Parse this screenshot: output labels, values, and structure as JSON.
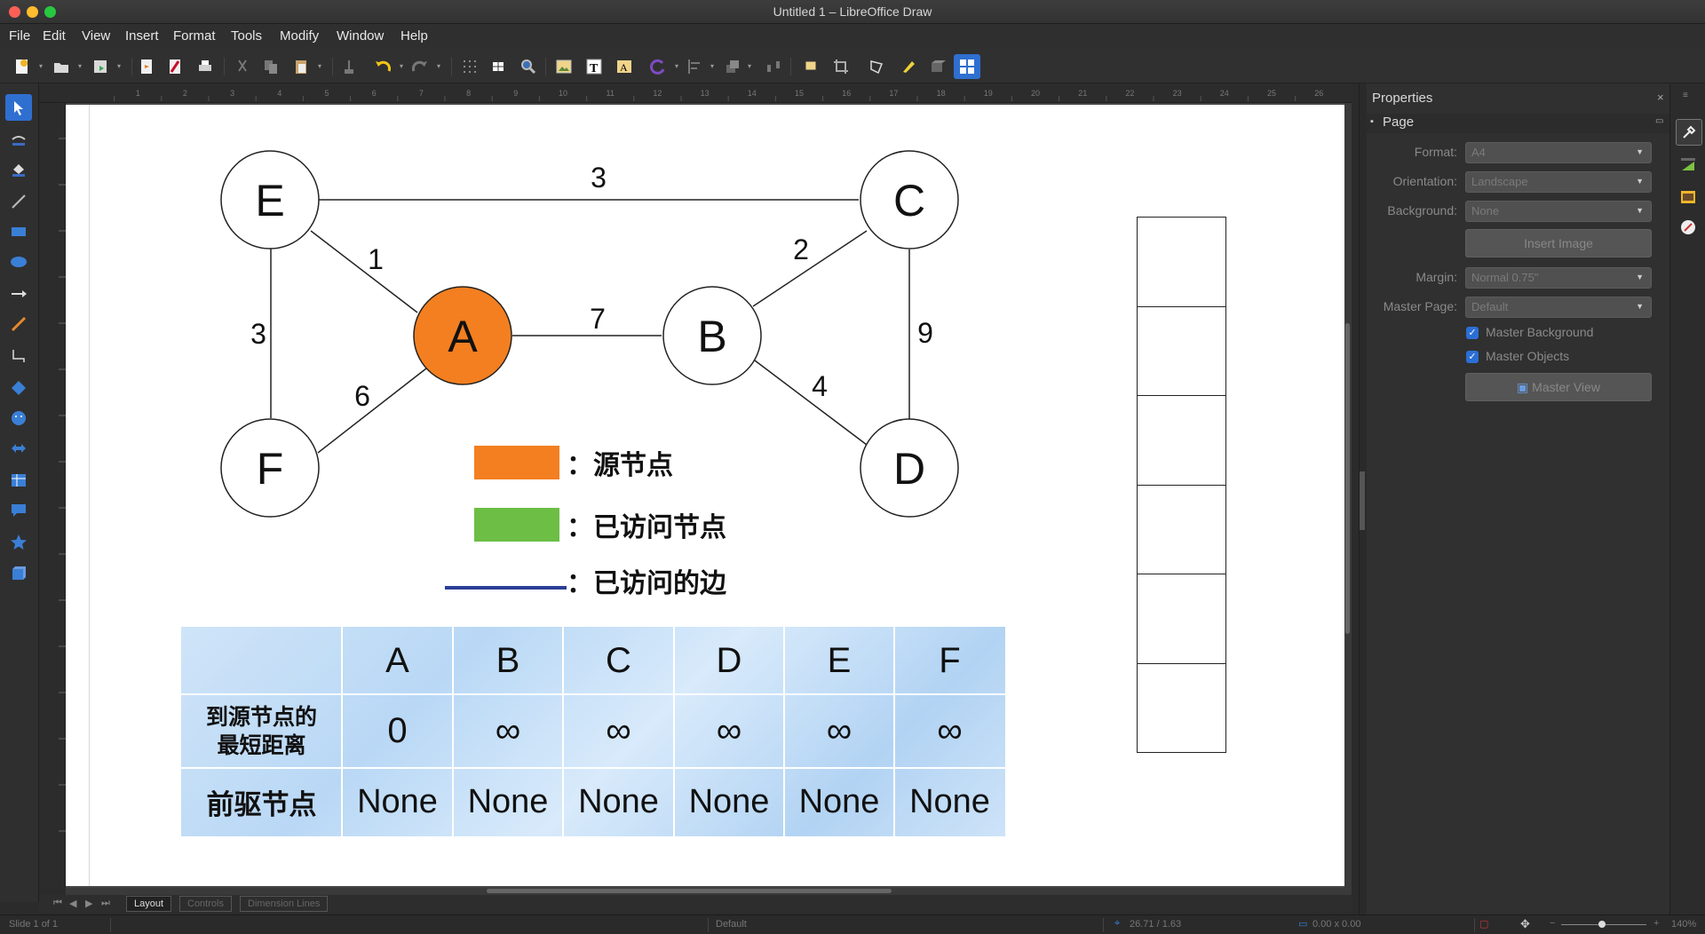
{
  "window": {
    "title": "Untitled 1 – LibreOffice Draw"
  },
  "menu": [
    "File",
    "Edit",
    "View",
    "Insert",
    "Format",
    "Tools",
    "Modify",
    "Window",
    "Help"
  ],
  "graph": {
    "nodes": {
      "A": "A",
      "B": "B",
      "C": "C",
      "D": "D",
      "E": "E",
      "F": "F"
    },
    "edge_weights": {
      "EC": "3",
      "EA": "1",
      "EF": "3",
      "AB": "7",
      "CB": "2",
      "CD": "9",
      "BD": "4",
      "AF": "6"
    },
    "source_color": "#f37f20",
    "visited_color": "#6cbe45",
    "visited_edge_color": "#2b3f97"
  },
  "legend": {
    "source": "：源节点",
    "visited_node": "：已访问节点",
    "visited_edge": "：已访问的边"
  },
  "table": {
    "header": [
      "",
      "A",
      "B",
      "C",
      "D",
      "E",
      "F"
    ],
    "row1_label_line1": "到源节点的",
    "row1_label_line2": "最短距离",
    "row1": [
      "0",
      "∞",
      "∞",
      "∞",
      "∞",
      "∞"
    ],
    "row2_label": "前驱节点",
    "row2": [
      "None",
      "None",
      "None",
      "None",
      "None",
      "None"
    ]
  },
  "queue": {
    "cells": 6
  },
  "sidebar": {
    "title": "Properties",
    "section": "Page",
    "format_label": "Format:",
    "format_value": "A4",
    "orientation_label": "Orientation:",
    "orientation_value": "Landscape",
    "background_label": "Background:",
    "background_value": "None",
    "insert_image": "Insert Image",
    "margin_label": "Margin:",
    "margin_value": "Normal 0.75\"",
    "master_page_label": "Master Page:",
    "master_page_value": "Default",
    "master_background": "Master Background",
    "master_objects": "Master Objects",
    "master_view": "Master View"
  },
  "tabs": [
    "Layout",
    "Controls",
    "Dimension Lines"
  ],
  "status": {
    "slide": "Slide 1 of 1",
    "layout": "Default",
    "position": "26.71 / 1.63",
    "size": "0.00 x 0.00",
    "zoom": "140%"
  },
  "ruler_numbers": [
    "1",
    "2",
    "3",
    "4",
    "5",
    "6",
    "7",
    "8",
    "9",
    "10",
    "11",
    "12",
    "13",
    "14",
    "15",
    "16",
    "17",
    "18",
    "19",
    "20",
    "21",
    "22",
    "23",
    "24",
    "25",
    "26"
  ]
}
